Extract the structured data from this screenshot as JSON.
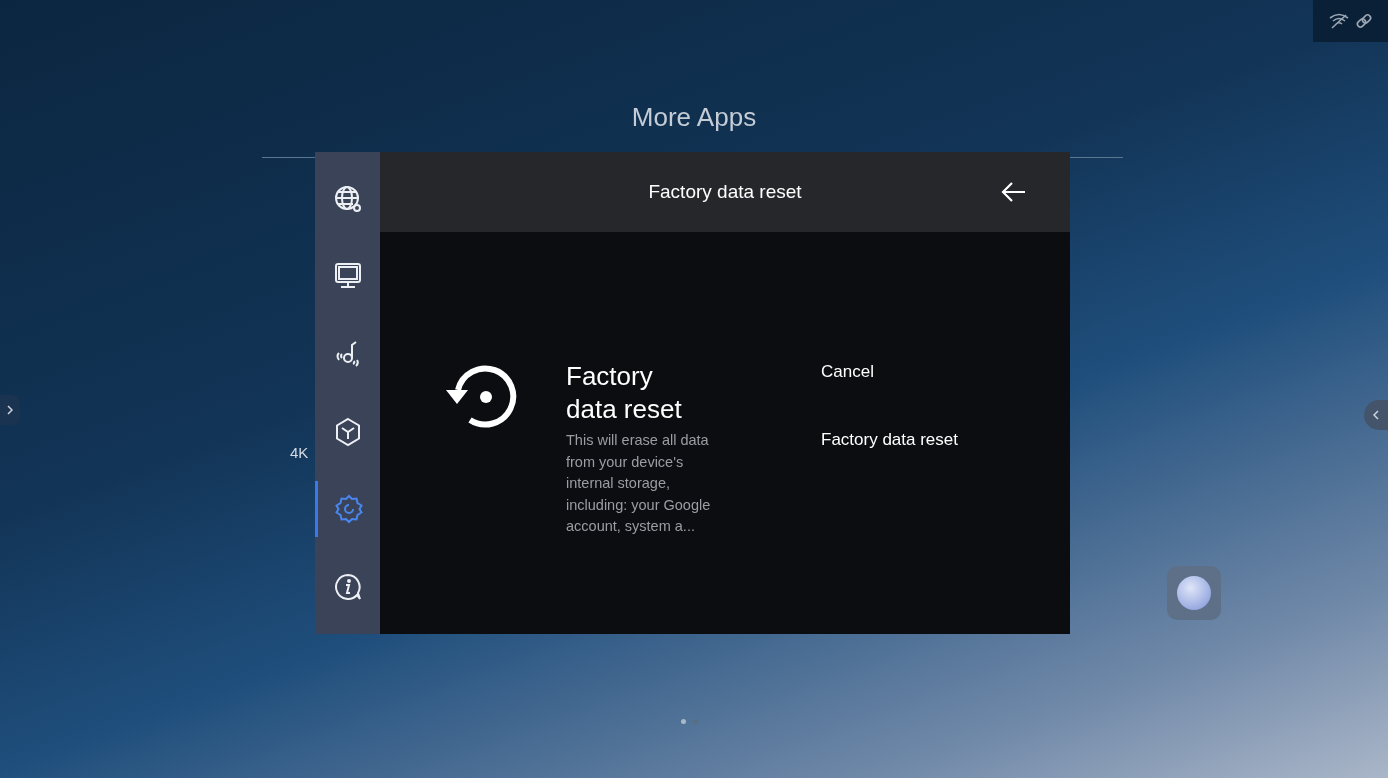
{
  "page_title": "More Apps",
  "background_app_label": "4K",
  "dialog": {
    "nav": [
      {
        "kind": "network",
        "selected": false
      },
      {
        "kind": "display",
        "selected": false
      },
      {
        "kind": "audio",
        "selected": false
      },
      {
        "kind": "apps",
        "selected": false
      },
      {
        "kind": "settings",
        "selected": true
      },
      {
        "kind": "info",
        "selected": false
      }
    ],
    "title": "Factory data reset",
    "heading": "Factory data reset",
    "description": "This will erase all data from your device's internal storage, including: your Google account, system a...",
    "actions": [
      "Cancel",
      "Factory data reset"
    ]
  },
  "pager": [
    {
      "selected": true
    },
    {
      "selected": false
    }
  ]
}
